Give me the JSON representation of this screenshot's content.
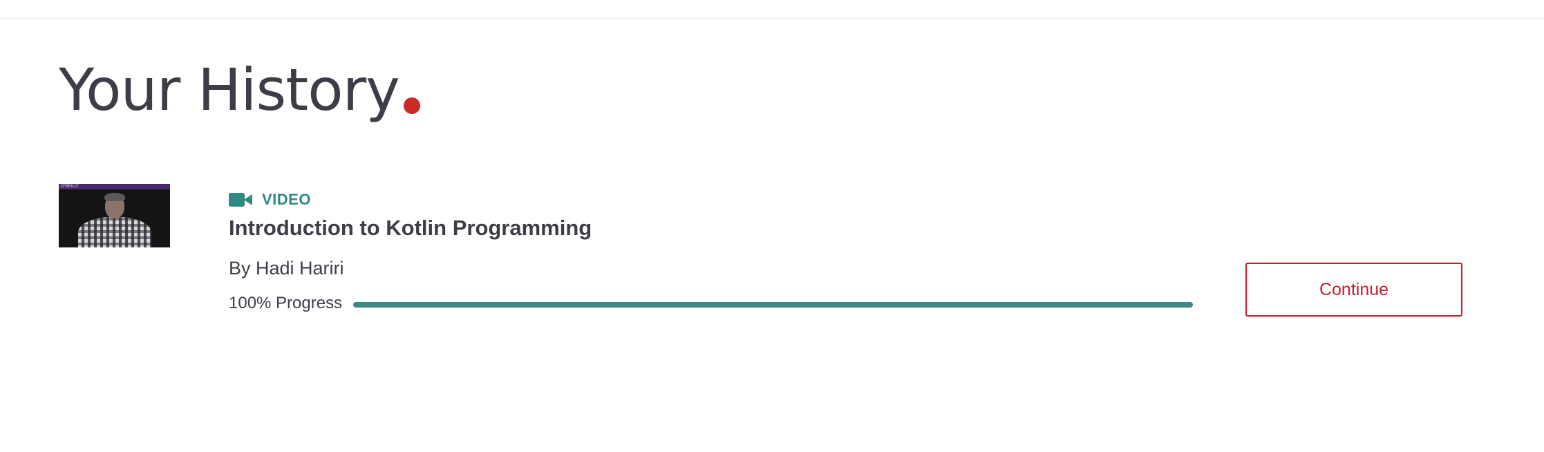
{
  "header": {
    "title": "Your History",
    "accent_color": "#cc2a25"
  },
  "history": {
    "items": [
      {
        "thumbnail_icon": "video-thumbnail-presenter",
        "thumbnail_brand": "O'REILLY",
        "type_icon": "video-camera-icon",
        "type_label": "VIDEO",
        "title": "Introduction to Kotlin Programming",
        "author": "By Hadi Hariri",
        "progress_text": "100% Progress",
        "progress_value": 1.0,
        "continue_label": "Continue"
      }
    ]
  },
  "colors": {
    "type_color": "#2f8a82",
    "progress_color": "#3b8884",
    "button_color": "#c41d2b",
    "text_color": "#3d3d48"
  }
}
